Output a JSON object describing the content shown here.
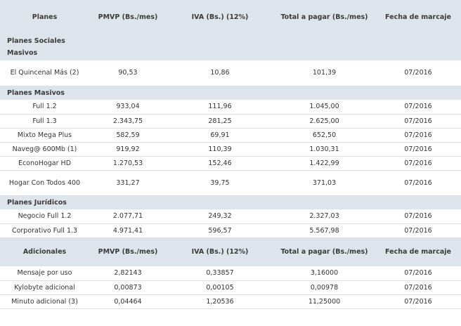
{
  "table": {
    "header": [
      "Planes",
      "PMVP (Bs./mes)",
      "IVA (Bs.) (12%)",
      "Total a pagar (Bs./mes)",
      "Fecha de marcaje"
    ],
    "sections": [
      {
        "title": "Planes Sociales Masivos",
        "rows": [
          [
            "El Quincenal Más (2)",
            "90,53",
            "10,86",
            "101,39",
            "07/2016"
          ]
        ]
      },
      {
        "title": "Planes Masivos",
        "rows": [
          [
            "Full 1.2",
            "933,04",
            "111,96",
            "1.045,00",
            "07/2016"
          ],
          [
            "Full 1.3",
            "2.343,75",
            "281,25",
            "2.625,00",
            "07/2016"
          ],
          [
            "Mixto Mega Plus",
            "582,59",
            "69,91",
            "652,50",
            "07/2016"
          ],
          [
            "Naveg@ 600Mb (1)",
            "919,92",
            "110,39",
            "1.030,31",
            "07/2016"
          ],
          [
            "EconoHogar HD",
            "1.270,53",
            "152,46",
            "1.422,99",
            "07/2016"
          ],
          [
            "Hogar Con Todos 400",
            "331,27",
            "39,75",
            "371,03",
            "07/2016"
          ]
        ]
      },
      {
        "title": "Planes Jurídicos",
        "rows": [
          [
            "Negocio Full 1.2",
            "2.077,71",
            "249,32",
            "2.327,03",
            "07/2016"
          ],
          [
            "Corporativo Full 1.3",
            "4.971,41",
            "596,57",
            "5.567,98",
            "07/2016"
          ]
        ]
      }
    ],
    "additional_header": [
      "Adicionales",
      "PMVP (Bs./mes)",
      "IVA (Bs.) (12%)",
      "Total a pagar (Bs./mes)",
      "Fecha de marcaje"
    ],
    "additional_rows": [
      [
        "Mensaje por uso",
        "2,82143",
        "0,33857",
        "3,16000",
        "07/2016"
      ],
      [
        "Kylobyte adicional",
        "0,00873",
        "0,00105",
        "0,00978",
        "07/2016"
      ],
      [
        "Minuto adicional (3)",
        "0,04464",
        "1,20536",
        "11,25000",
        "07/2016"
      ]
    ]
  }
}
